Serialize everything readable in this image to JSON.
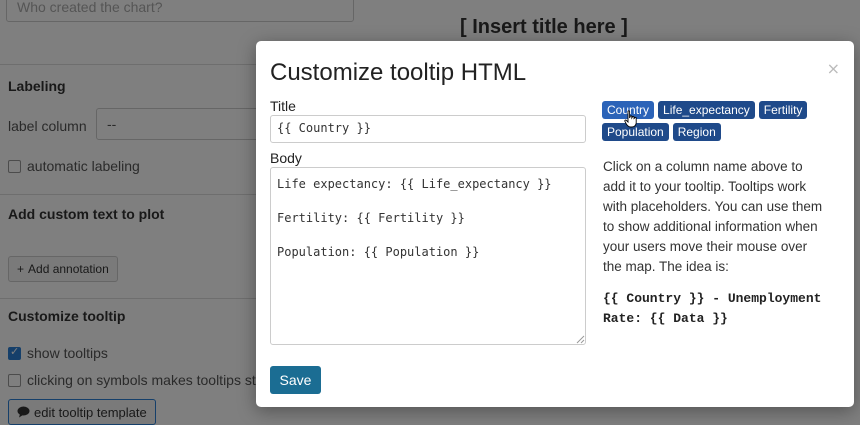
{
  "sidebar": {
    "description_placeholder": "Who created the chart?",
    "labeling_title": "Labeling",
    "label_column_label": "label column",
    "label_column_value": "--",
    "automatic_labeling_label": "automatic labeling",
    "custom_text_title": "Add custom text to plot",
    "add_annotation_label": "Add annotation",
    "customize_tooltip_title": "Customize tooltip",
    "show_tooltips_label": "show tooltips",
    "show_tooltips_checked": true,
    "sticky_tooltips_label": "clicking on symbols makes tooltips stick",
    "edit_template_label": "edit tooltip template"
  },
  "chart": {
    "title_placeholder": "[ Insert title here ]"
  },
  "modal": {
    "title": "Customize tooltip HTML",
    "close_symbol": "×",
    "title_field_label": "Title",
    "title_field_value": "{{ Country }}",
    "body_field_label": "Body",
    "body_field_value": "Life expectancy: {{ Life_expectancy }}\n\nFertility: {{ Fertility }}\n\nPopulation: {{ Population }}",
    "save_label": "Save",
    "columns": [
      "Country",
      "Life_expectancy",
      "Fertility",
      "Population",
      "Region"
    ],
    "help_text": "Click on a column name above to add it to your tooltip. Tooltips work with placeholders. You can use them to show additional information when your users move their mouse over the map. The idea is:",
    "help_code": "{{ Country }} - Unemployment Rate: {{ Data }}"
  },
  "colors": {
    "chip": "#1f4a8a",
    "chip_active": "#2b63b8",
    "save_button": "#1b6d93",
    "overlay": "rgba(0,0,0,0.5)"
  }
}
